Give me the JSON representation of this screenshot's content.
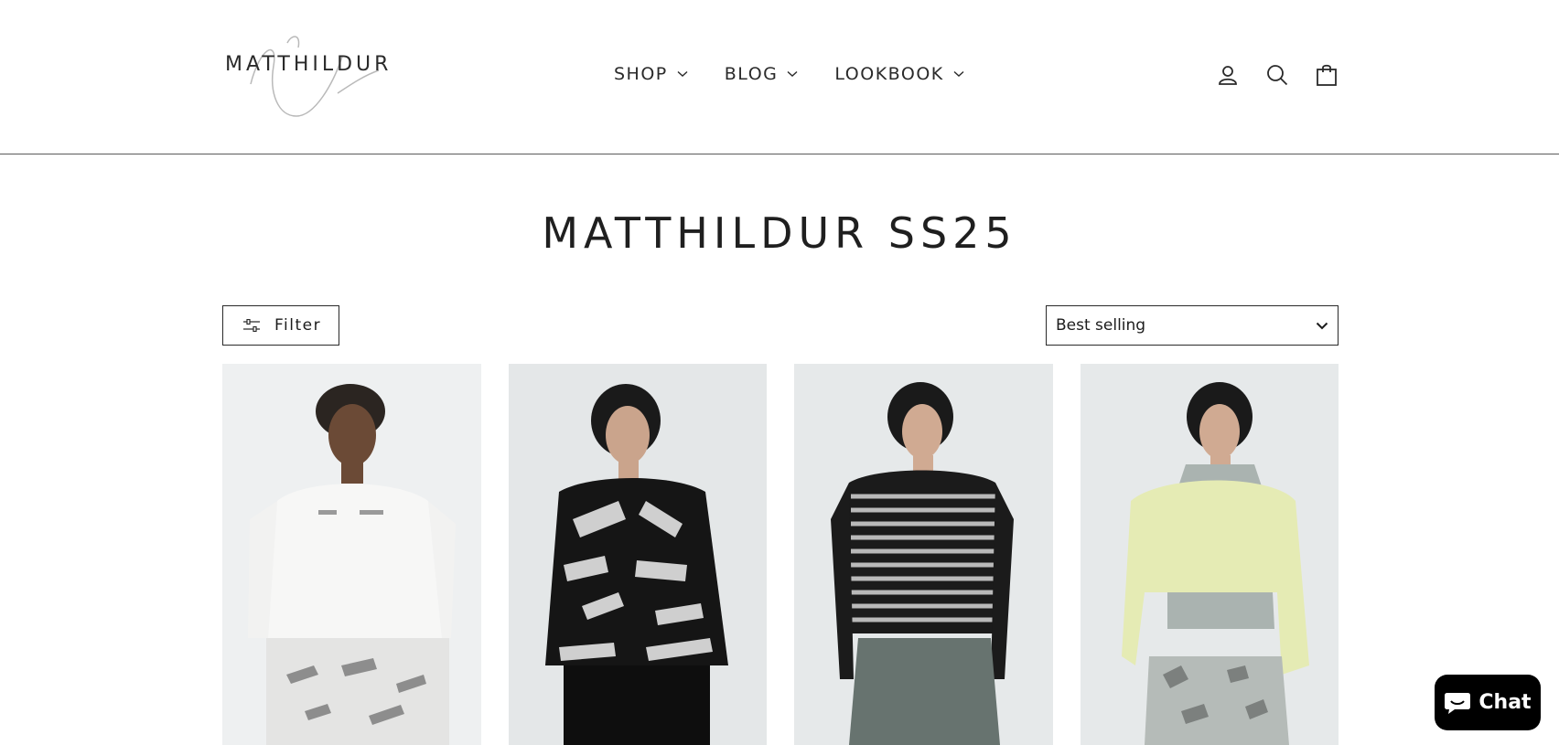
{
  "brand": {
    "name": "MATTHILDUR"
  },
  "nav": {
    "items": [
      {
        "label": "SHOP"
      },
      {
        "label": "BLOG"
      },
      {
        "label": "LOOKBOOK"
      }
    ]
  },
  "header_icons": [
    "account-icon",
    "search-icon",
    "cart-icon"
  ],
  "page": {
    "title": "MATTHILDUR SS25"
  },
  "toolbar": {
    "filter_label": "Filter",
    "sort_selected": "Best selling"
  },
  "products": [
    {
      "image": "white-top-product-image"
    },
    {
      "image": "black-pattern-top-product-image"
    },
    {
      "image": "striped-sweater-product-image"
    },
    {
      "image": "yellow-sweater-product-image"
    }
  ],
  "chat": {
    "label": "Chat"
  },
  "colors": {
    "header_border": "#5a5a5a",
    "card_bg": "#e6e9ea",
    "chat_bg": "#000000"
  }
}
